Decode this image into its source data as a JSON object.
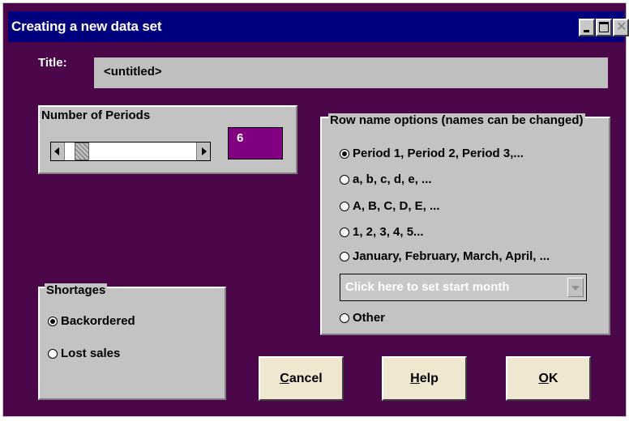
{
  "window": {
    "title": "Creating a new data set",
    "close_glyph": "✕"
  },
  "title_field": {
    "label": "Title:",
    "value": "<untitled>"
  },
  "periods": {
    "label": "Number of Periods",
    "value": "6",
    "slider_fraction": 0.08,
    "value_bg": "#800080"
  },
  "row_names": {
    "legend": "Row name options (names can be changed)",
    "options": [
      {
        "label": "Period 1, Period 2, Period 3,...",
        "selected": true
      },
      {
        "label": "a, b, c, d, e, ...",
        "selected": false
      },
      {
        "label": "A, B, C, D, E, ...",
        "selected": false
      },
      {
        "label": "1, 2, 3, 4, 5...",
        "selected": false
      },
      {
        "label": "January, February, March, April, ...",
        "selected": false
      },
      {
        "label": "Other",
        "selected": false
      }
    ],
    "month_dropdown": {
      "value": "Click here to set start month"
    }
  },
  "shortages": {
    "legend": "Shortages",
    "options": [
      {
        "label": "Backordered",
        "selected": true
      },
      {
        "label": "Lost sales",
        "selected": false
      }
    ]
  },
  "buttons": {
    "cancel": {
      "mnemonic": "C",
      "rest": "ancel"
    },
    "help": {
      "mnemonic": "H",
      "rest": "elp"
    },
    "ok": {
      "mnemonic": "O",
      "rest": "K"
    }
  },
  "colors": {
    "background": "#4a0648",
    "titlebar": "#00007e",
    "panel": "#c3c3c3",
    "button_face": "#efe7cf"
  },
  "icons": {
    "minimize": "minimize-icon",
    "maximize": "maximize-icon",
    "close": "close-icon",
    "arrow_left": "arrow-left-icon",
    "arrow_right": "arrow-right-icon",
    "dropdown": "chevron-down-icon"
  }
}
